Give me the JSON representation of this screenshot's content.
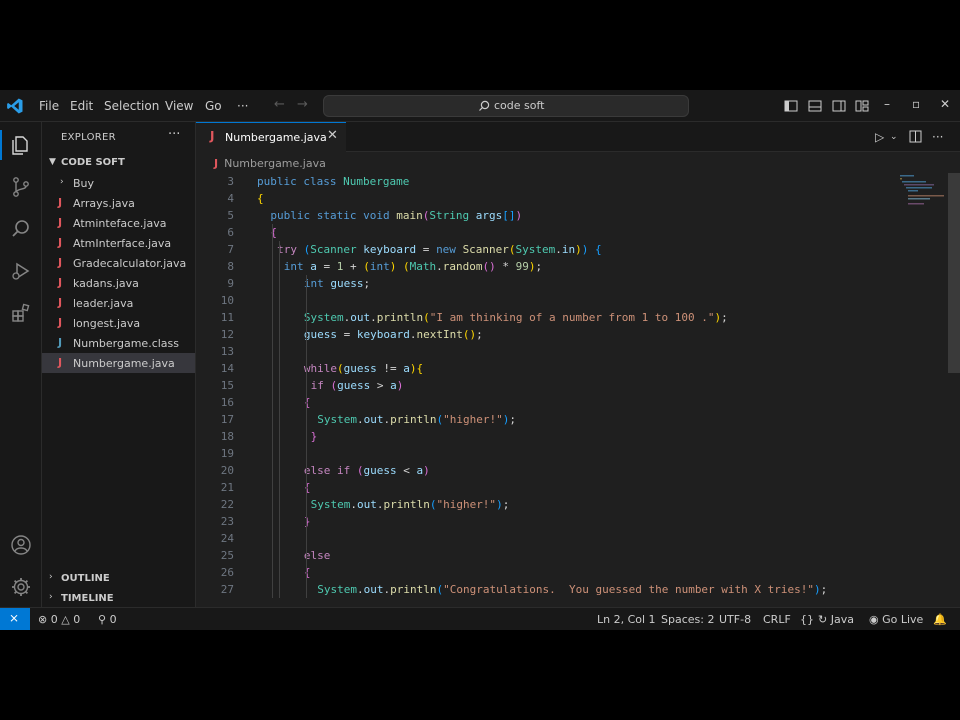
{
  "titlebar": {
    "menu": [
      "File",
      "Edit",
      "Selection",
      "View",
      "Go",
      "···"
    ],
    "search_text": "code soft",
    "window_controls": [
      "–",
      "▫",
      "✕"
    ]
  },
  "sidebar": {
    "title": "EXPLORER",
    "more": "···",
    "root_folder": "CODE SOFT",
    "items": [
      {
        "type": "folder",
        "label": "Buy"
      },
      {
        "type": "java",
        "label": "Arrays.java"
      },
      {
        "type": "java",
        "label": "Atminteface.java"
      },
      {
        "type": "java",
        "label": "AtmInterface.java"
      },
      {
        "type": "java",
        "label": "Gradecalculator.java"
      },
      {
        "type": "java",
        "label": "kadans.java"
      },
      {
        "type": "java",
        "label": "leader.java"
      },
      {
        "type": "java",
        "label": "longest.java"
      },
      {
        "type": "class",
        "label": "Numbergame.class"
      },
      {
        "type": "java",
        "label": "Numbergame.java",
        "selected": true
      }
    ],
    "outline": "OUTLINE",
    "timeline": "TIMELINE"
  },
  "editor": {
    "tab_label": "Numbergame.java",
    "tab_close": "✕",
    "breadcrumb": "Numbergame.java",
    "icon_letter": "J",
    "lines": [
      {
        "n": 3,
        "indent": 0,
        "tokens": [
          [
            "kw",
            "public"
          ],
          [
            "op",
            " "
          ],
          [
            "kw",
            "class"
          ],
          [
            "op",
            " "
          ],
          [
            "ty",
            "Numbergame"
          ]
        ]
      },
      {
        "n": 4,
        "indent": 0,
        "tokens": [
          [
            "b1",
            "{"
          ]
        ]
      },
      {
        "n": 5,
        "indent": 2,
        "tokens": [
          [
            "kw",
            "public"
          ],
          [
            "op",
            " "
          ],
          [
            "kw",
            "static"
          ],
          [
            "op",
            " "
          ],
          [
            "kw",
            "void"
          ],
          [
            "op",
            " "
          ],
          [
            "fn",
            "main"
          ],
          [
            "b2",
            "("
          ],
          [
            "ty",
            "String"
          ],
          [
            "op",
            " "
          ],
          [
            "vr",
            "args"
          ],
          [
            "b3",
            "[]"
          ],
          [
            "b2",
            ")"
          ]
        ]
      },
      {
        "n": 6,
        "indent": 2,
        "tokens": [
          [
            "b2",
            "{"
          ]
        ]
      },
      {
        "n": 7,
        "indent": 3,
        "tokens": [
          [
            "cf",
            "try"
          ],
          [
            "op",
            " "
          ],
          [
            "b3",
            "("
          ],
          [
            "ty",
            "Scanner"
          ],
          [
            "op",
            " "
          ],
          [
            "vr",
            "keyboard"
          ],
          [
            "op",
            " = "
          ],
          [
            "kw",
            "new"
          ],
          [
            "op",
            " "
          ],
          [
            "fn",
            "Scanner"
          ],
          [
            "b1",
            "("
          ],
          [
            "ty",
            "System"
          ],
          [
            "op",
            "."
          ],
          [
            "vr",
            "in"
          ],
          [
            "b1",
            ")"
          ],
          [
            "b3",
            ")"
          ],
          [
            "op",
            " "
          ],
          [
            "b3",
            "{"
          ]
        ]
      },
      {
        "n": 8,
        "indent": 4,
        "tokens": [
          [
            "kw",
            "int"
          ],
          [
            "op",
            " "
          ],
          [
            "vr",
            "a"
          ],
          [
            "op",
            " = "
          ],
          [
            "nm",
            "1"
          ],
          [
            "op",
            " + "
          ],
          [
            "b1",
            "("
          ],
          [
            "kw",
            "int"
          ],
          [
            "b1",
            ")"
          ],
          [
            "op",
            " "
          ],
          [
            "b1",
            "("
          ],
          [
            "ty",
            "Math"
          ],
          [
            "op",
            "."
          ],
          [
            "fn",
            "random"
          ],
          [
            "b2",
            "()"
          ],
          [
            "op",
            " * "
          ],
          [
            "nm",
            "99"
          ],
          [
            "b1",
            ")"
          ],
          [
            "op",
            ";"
          ]
        ]
      },
      {
        "n": 9,
        "indent": 7,
        "tokens": [
          [
            "kw",
            "int"
          ],
          [
            "op",
            " "
          ],
          [
            "vr",
            "guess"
          ],
          [
            "op",
            ";"
          ]
        ]
      },
      {
        "n": 10,
        "indent": 0,
        "tokens": []
      },
      {
        "n": 11,
        "indent": 7,
        "tokens": [
          [
            "ty",
            "System"
          ],
          [
            "op",
            "."
          ],
          [
            "vr",
            "out"
          ],
          [
            "op",
            "."
          ],
          [
            "fn",
            "println"
          ],
          [
            "b1",
            "("
          ],
          [
            "st",
            "\"I am thinking of a number from 1 to 100 .\""
          ],
          [
            "b1",
            ")"
          ],
          [
            "op",
            ";"
          ]
        ]
      },
      {
        "n": 12,
        "indent": 7,
        "tokens": [
          [
            "vr",
            "guess"
          ],
          [
            "op",
            " = "
          ],
          [
            "vr",
            "keyboard"
          ],
          [
            "op",
            "."
          ],
          [
            "fn",
            "nextInt"
          ],
          [
            "b1",
            "()"
          ],
          [
            "op",
            ";"
          ]
        ]
      },
      {
        "n": 13,
        "indent": 0,
        "tokens": []
      },
      {
        "n": 14,
        "indent": 7,
        "tokens": [
          [
            "cf",
            "while"
          ],
          [
            "b1",
            "("
          ],
          [
            "vr",
            "guess"
          ],
          [
            "op",
            " != "
          ],
          [
            "vr",
            "a"
          ],
          [
            "b1",
            ")"
          ],
          [
            "b1",
            "{"
          ]
        ]
      },
      {
        "n": 15,
        "indent": 8,
        "tokens": [
          [
            "cf",
            "if"
          ],
          [
            "op",
            " "
          ],
          [
            "b2",
            "("
          ],
          [
            "vr",
            "guess"
          ],
          [
            "op",
            " > "
          ],
          [
            "vr",
            "a"
          ],
          [
            "b2",
            ")"
          ]
        ]
      },
      {
        "n": 16,
        "indent": 7,
        "tokens": [
          [
            "b2",
            "{"
          ]
        ]
      },
      {
        "n": 17,
        "indent": 9,
        "tokens": [
          [
            "ty",
            "System"
          ],
          [
            "op",
            "."
          ],
          [
            "vr",
            "out"
          ],
          [
            "op",
            "."
          ],
          [
            "fn",
            "println"
          ],
          [
            "b3",
            "("
          ],
          [
            "st",
            "\"higher!\""
          ],
          [
            "b3",
            ")"
          ],
          [
            "op",
            ";"
          ]
        ]
      },
      {
        "n": 18,
        "indent": 8,
        "tokens": [
          [
            "b2",
            "}"
          ]
        ]
      },
      {
        "n": 19,
        "indent": 0,
        "tokens": []
      },
      {
        "n": 20,
        "indent": 7,
        "tokens": [
          [
            "cf",
            "else"
          ],
          [
            "op",
            " "
          ],
          [
            "cf",
            "if"
          ],
          [
            "op",
            " "
          ],
          [
            "b2",
            "("
          ],
          [
            "vr",
            "guess"
          ],
          [
            "op",
            " < "
          ],
          [
            "vr",
            "a"
          ],
          [
            "b2",
            ")"
          ]
        ]
      },
      {
        "n": 21,
        "indent": 7,
        "tokens": [
          [
            "b2",
            "{"
          ]
        ]
      },
      {
        "n": 22,
        "indent": 8,
        "tokens": [
          [
            "ty",
            "System"
          ],
          [
            "op",
            "."
          ],
          [
            "vr",
            "out"
          ],
          [
            "op",
            "."
          ],
          [
            "fn",
            "println"
          ],
          [
            "b3",
            "("
          ],
          [
            "st",
            "\"higher!\""
          ],
          [
            "b3",
            ")"
          ],
          [
            "op",
            ";"
          ]
        ]
      },
      {
        "n": 23,
        "indent": 7,
        "tokens": [
          [
            "b2",
            "}"
          ]
        ]
      },
      {
        "n": 24,
        "indent": 0,
        "tokens": []
      },
      {
        "n": 25,
        "indent": 7,
        "tokens": [
          [
            "cf",
            "else"
          ]
        ]
      },
      {
        "n": 26,
        "indent": 7,
        "tokens": [
          [
            "b2",
            "{"
          ]
        ]
      },
      {
        "n": 27,
        "indent": 9,
        "tokens": [
          [
            "ty",
            "System"
          ],
          [
            "op",
            "."
          ],
          [
            "vr",
            "out"
          ],
          [
            "op",
            "."
          ],
          [
            "fn",
            "println"
          ],
          [
            "b3",
            "("
          ],
          [
            "st",
            "\"Congratulations.  You guessed the number with X tries!\""
          ],
          [
            "b3",
            ")"
          ],
          [
            "op",
            ";"
          ]
        ]
      }
    ]
  },
  "statusbar": {
    "errors": "0",
    "warnings": "0",
    "ports": "0",
    "position": "Ln 2, Col 1",
    "spaces": "Spaces: 2",
    "encoding": "UTF-8",
    "eol": "CRLF",
    "braces": "{}",
    "language": "Java",
    "golive": "Go Live"
  },
  "colors": {
    "accent": "#0078d4",
    "java_icon": "#e0575d",
    "class_icon": "#519aba"
  }
}
